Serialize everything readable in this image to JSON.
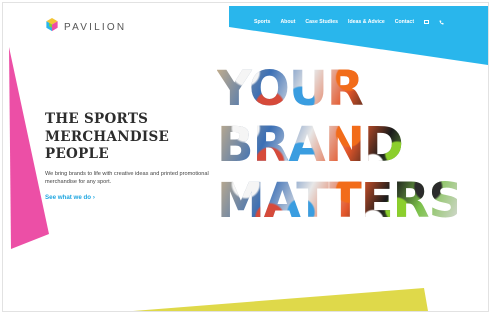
{
  "brand": {
    "name": "PAVILION",
    "logo_icon": "hexagon-cube-icon"
  },
  "nav": {
    "items": [
      {
        "label": "Sports"
      },
      {
        "label": "About"
      },
      {
        "label": "Case Studies"
      },
      {
        "label": "Ideas & Advice"
      },
      {
        "label": "Contact"
      }
    ],
    "icons": [
      "mail-icon",
      "phone-icon"
    ]
  },
  "hero": {
    "headline_lines": [
      "THE SPORTS",
      "MERCHANDISE",
      "PEOPLE"
    ],
    "subtext": "We bring brands to life with creative ideas and printed promotional merchandise for any sport.",
    "cta": "See what we do",
    "cta_arrow": "›",
    "big_words": [
      "YOUR",
      "BRAND",
      "MATTERS"
    ]
  },
  "colors": {
    "cyan": "#29b6ec",
    "magenta": "#ec4fa6",
    "yellow": "#dfd94a",
    "headline": "#2d2d2d",
    "link": "#1fa6e0"
  }
}
